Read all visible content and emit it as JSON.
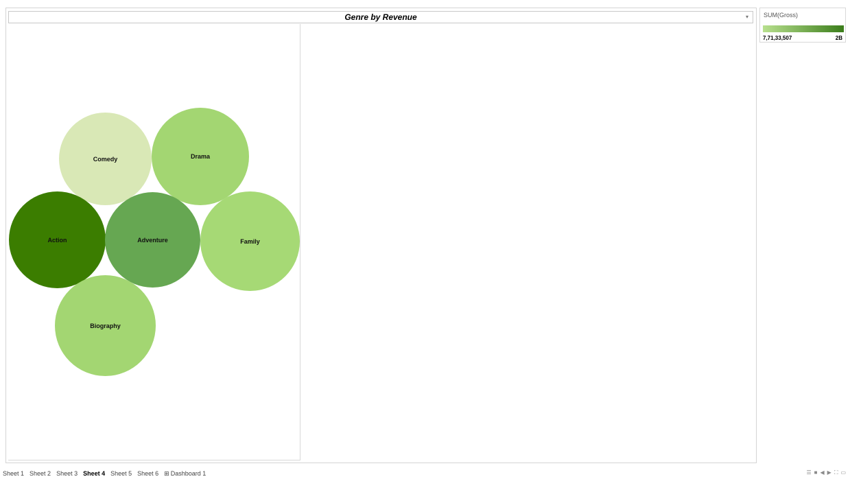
{
  "sheet_title": "Genre by Revenue",
  "dropdown_icon": "dropdown-caret-icon",
  "legend": {
    "title": "SUM(Gross)",
    "min_label": "7,71,33,507",
    "max_label": "2B",
    "low_color": "#b8e08e",
    "high_color": "#3b7d1b"
  },
  "bubbles": [
    {
      "label": "Comedy",
      "color": "#d9e8b6"
    },
    {
      "label": "Drama",
      "color": "#a3d672"
    },
    {
      "label": "Action",
      "color": "#3b7d00"
    },
    {
      "label": "Adventure",
      "color": "#66a752"
    },
    {
      "label": "Family",
      "color": "#a6d975"
    },
    {
      "label": "Biography",
      "color": "#a3d672"
    }
  ],
  "tabs": [
    {
      "label": "Sheet 1",
      "active": false
    },
    {
      "label": "Sheet 2",
      "active": false
    },
    {
      "label": "Sheet 3",
      "active": false
    },
    {
      "label": "Sheet 4",
      "active": true
    },
    {
      "label": "Sheet 5",
      "active": false
    },
    {
      "label": "Sheet 6",
      "active": false
    },
    {
      "label": "Dashboard 1",
      "active": false,
      "icon": "dashboard-grid-icon"
    }
  ],
  "status_icons": [
    "grid-view-icon",
    "tile-view-icon",
    "prev-arrow-icon",
    "next-arrow-icon",
    "fullscreen-icon",
    "presentation-icon"
  ]
}
